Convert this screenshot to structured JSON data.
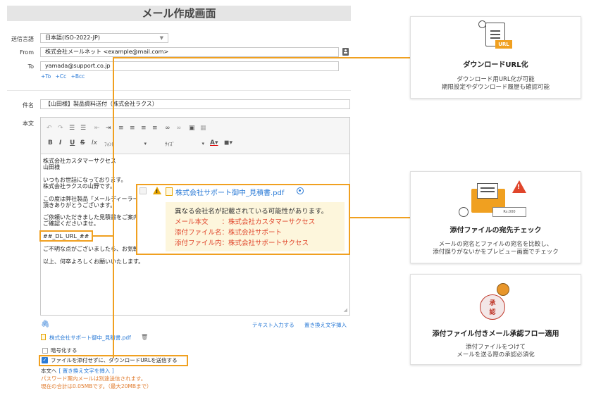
{
  "page_title": "メール作成画面",
  "form": {
    "charset_label": "送信言語",
    "charset_value": "日本語(ISO-2022-JP)",
    "from_label": "From",
    "from_value": "株式会社メールネット <example@mail.com>",
    "to_label": "To",
    "to_value": "yamada@support.co.jp",
    "add_to": "+To",
    "add_cc": "+Cc",
    "add_bcc": "+Bcc",
    "subject_label": "件名",
    "subject_value": "【山田様】製品資料送付（株式会社ラクス）",
    "body_label": "本文"
  },
  "toolbar": {
    "font_select": "ﾌｫﾝﾄ",
    "size_select": "ｻｲｽﾞ"
  },
  "body": {
    "line1": "株式会社カスタマーサクセス",
    "line2": "山田様",
    "line3": "いつもお世話になっております。",
    "line4": "株式会社ラクスの山野です。",
    "line5": "この度は弊社製品「メールディーラー",
    "line6": "頂きありがとうございます。",
    "line7": "ご依頼いただきました見積書をご案内",
    "line8": "ご確認くださいませ。",
    "placeholder": "##_DL_URL_##",
    "line9": "ご不明な点がございましたら、お気軽",
    "line10": "以上、何卒よろしくお願いいたします。"
  },
  "popup": {
    "filename": "株式会社サポート御中_見積書.pdf",
    "warning_title": "異なる会社名が記載されている可能性があります。",
    "row1": "メール本文　　：株式会社カスタマーサクセス",
    "row2": "添付ファイル名：株式会社サポート",
    "row3": "添付ファイル内：株式会社サポートサクセス"
  },
  "editor_links": {
    "text_input": "テキスト入力する",
    "replace_insert": "置き換え文字挿入"
  },
  "attachment": {
    "filename": "株式会社サポート御中_見積書.pdf",
    "encrypt_label": "暗号化する",
    "dl_url_label": "ファイルを添付せずに、ダウンロードURLを送信する",
    "body_to_prefix": "本文へ",
    "body_to_link": "[ 置き換え文字を挿入 ]",
    "pw_note": "パスワード案内メールは別途送信されます。",
    "size_note": "現在の合計は0.05MBです。（最大20MBまで）"
  },
  "cards": {
    "download": {
      "title": "ダウンロードURL化",
      "desc1": "ダウンロード用URL化が可能",
      "desc2": "期限設定やダウンロード履歴も確認可能",
      "icon_badge": "URL"
    },
    "check": {
      "title": "添付ファイルの宛先チェック",
      "desc1": "メールの宛名とファイルの宛名を比較し、",
      "desc2": "添付誤りがないかをプレビュー画面でチェック",
      "icon_text": "Rs.000"
    },
    "approval": {
      "title": "添付ファイル付きメール承認フロー適用",
      "desc1": "添付ファイルをつけて",
      "desc2": "メールを送る際の承認必須化",
      "stamp1": "承",
      "stamp2": "認"
    }
  },
  "colors": {
    "accent": "#f0a020",
    "link": "#2a7ad6",
    "warning_text": "#e0452b",
    "warning_bg": "#fdf6dc"
  }
}
